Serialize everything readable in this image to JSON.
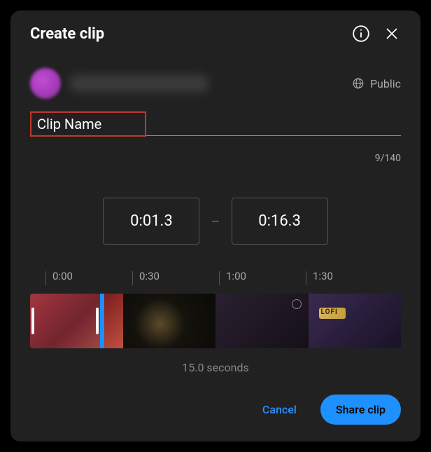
{
  "header": {
    "title": "Create clip"
  },
  "visibility": {
    "label": "Public"
  },
  "clip": {
    "name_value": "Clip Name",
    "char_count": "9/140"
  },
  "times": {
    "start": "0:01.3",
    "end": "0:16.3",
    "separator": "–"
  },
  "timeline": {
    "ticks": [
      "0:00",
      "0:30",
      "1:00",
      "1:30"
    ],
    "duration_label": "15.0 seconds"
  },
  "footer": {
    "cancel": "Cancel",
    "share": "Share clip"
  }
}
